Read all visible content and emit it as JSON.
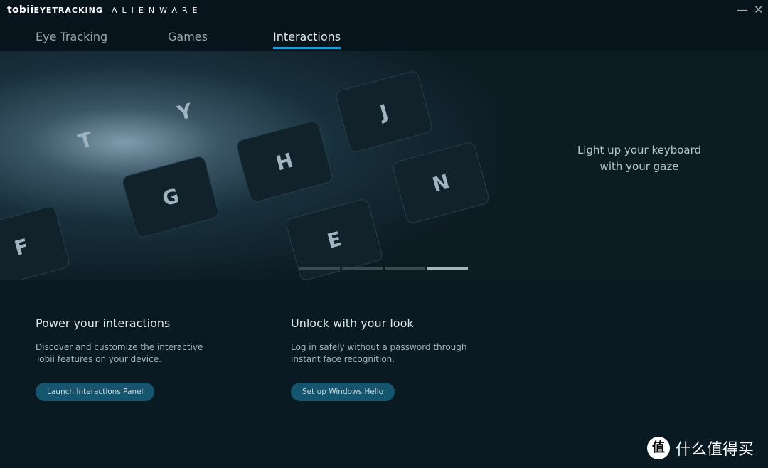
{
  "header": {
    "brand": "tobii",
    "brand_sub": "EYETRACKING",
    "partner": "ALIENWARE",
    "minimize": "—",
    "close": "✕"
  },
  "tabs": [
    {
      "label": "Eye Tracking",
      "active": false
    },
    {
      "label": "Games",
      "active": false
    },
    {
      "label": "Interactions",
      "active": true
    }
  ],
  "hero": {
    "text": "Light up your keyboard with your gaze",
    "slides": 4,
    "active_slide": 4,
    "keys": [
      "G",
      "H",
      "Y",
      "T",
      "F",
      "E",
      "N",
      "J"
    ]
  },
  "cards": [
    {
      "title": "Power your interactions",
      "body": "Discover and customize the interactive Tobii features on your device.",
      "button": "Launch Interactions Panel"
    },
    {
      "title": "Unlock with your look",
      "body": "Log in safely without a password through instant face recognition.",
      "button": "Set up Windows Hello"
    }
  ],
  "watermark": {
    "icon": "值",
    "text": "什么值得买"
  },
  "colors": {
    "accent": "#1a9ad6",
    "button": "#15566e",
    "background": "#0a1a22"
  }
}
